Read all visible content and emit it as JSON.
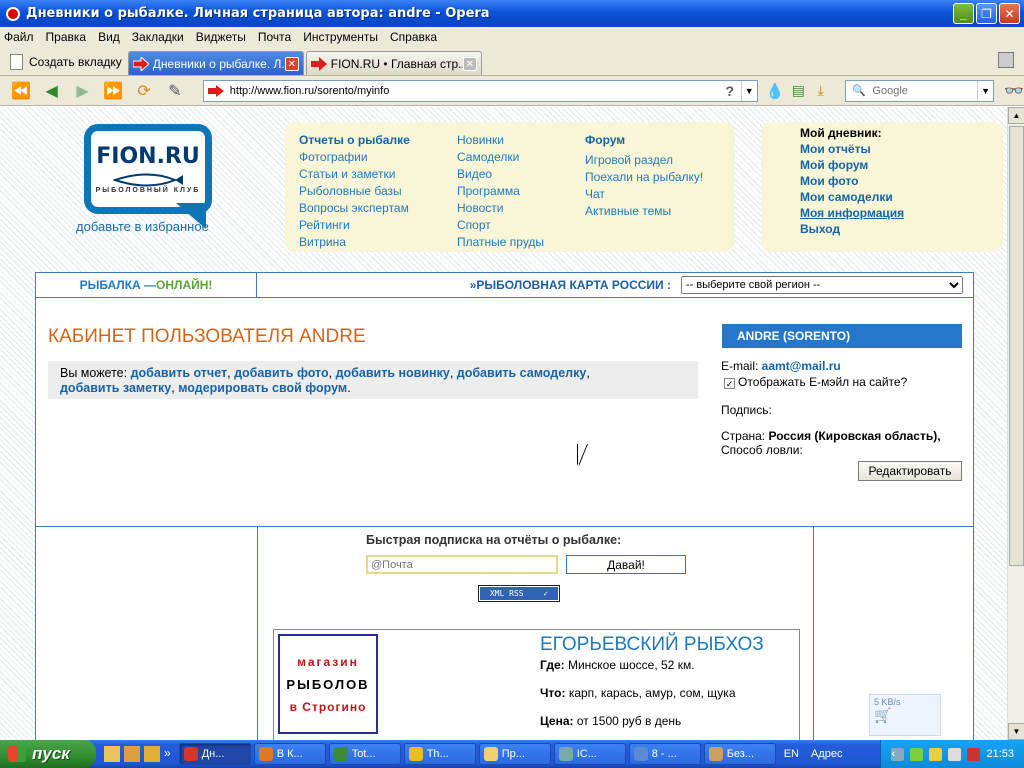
{
  "window": {
    "title": "Дневники о рыбалке. Личная страница автора: andre - Opera"
  },
  "menubar": [
    "Файл",
    "Правка",
    "Вид",
    "Закладки",
    "Виджеты",
    "Почта",
    "Инструменты",
    "Справка"
  ],
  "tabs": {
    "new_tab": "Создать вкладку",
    "items": [
      {
        "label": "Дневники о рыбалке. Л..."
      },
      {
        "label": "FION.RU • Главная стр..."
      }
    ]
  },
  "nav": {
    "url": "http://www.fion.ru/sorento/myinfo",
    "search_placeholder": "Google"
  },
  "site": {
    "logo_text": "FION.RU",
    "logo_sub": "РЫБОЛОВНЫЙ КЛУБ",
    "favorites": "добавьте в избранное",
    "menu_col1": [
      "Отчеты о рыбалке",
      "Фотографии",
      "Статьи и заметки",
      "Рыболовные базы",
      "Вопросы экспертам",
      "Рейтинги",
      "Витрина"
    ],
    "menu_col2": [
      "Новинки",
      "Самоделки",
      "Видео",
      "Программа",
      "Новости",
      "Спорт",
      "Платные пруды"
    ],
    "menu_col3": [
      "Форум",
      "Игровой раздел",
      "Поехали на рыбалку!",
      "Чат",
      "Активные темы"
    ],
    "my": {
      "heading": "Мой дневник:",
      "links": [
        "Мои отчёты",
        "Мой форум",
        "Мои фото",
        "Мои самоделки",
        "Моя информация",
        "Выход"
      ]
    },
    "strip": {
      "online_a": "РЫБАЛКА — ",
      "online_b": "ОНЛАЙН!",
      "map_label": "»РЫБОЛОВНАЯ КАРТА РОССИИ :",
      "region_select": "-- выберите свой регион --"
    },
    "cabinet": {
      "title": "КАБИНЕТ ПОЛЬЗОВАТЕЛЯ ANDRE",
      "can_prefix": "Вы можете: ",
      "actions": [
        "добавить отчет",
        "добавить фото",
        "добавить новинку",
        "добавить самоделку",
        "добавить заметку",
        "модерировать свой форум"
      ]
    },
    "user": {
      "header": "ANDRE (SORENTO)",
      "email_label": "E-mail: ",
      "email": "aamt@mail.ru",
      "show_email": "Отображать E-мэйл на сайте?",
      "signature_label": "Подпись:",
      "country_label": "Страна: ",
      "country": "Россия (Кировская область),",
      "method_label": "Способ ловли:",
      "edit_button": "Редактировать"
    },
    "subscribe": {
      "title": "Быстрая подписка на отчёты о рыбалке:",
      "placeholder": "@Почта",
      "button": "Давай!",
      "rss_badge": "XML RSS"
    },
    "ad": {
      "shop_line1": "магазин",
      "shop_line2": "РЫБОЛОВ",
      "shop_line3": "в Строгино",
      "title": "ЕГОРЬЕВСКИЙ РЫБХОЗ",
      "where_label": "Где:",
      "where": " Минское шоссе, 52 км.",
      "what_label": "Что:",
      "what": " карп, карась, амур, сом, щука",
      "price_label": "Цена:",
      "price": " от 1500 руб в день"
    },
    "speed": "5 KB/s"
  },
  "taskbar": {
    "start": "пуск",
    "tasks": [
      "Дн...",
      "В К...",
      "Tot...",
      "Th...",
      "Пр...",
      "IC...",
      "8 - ...",
      "Без..."
    ],
    "lang": "EN",
    "address": "Адрес",
    "clock": "21:53"
  }
}
